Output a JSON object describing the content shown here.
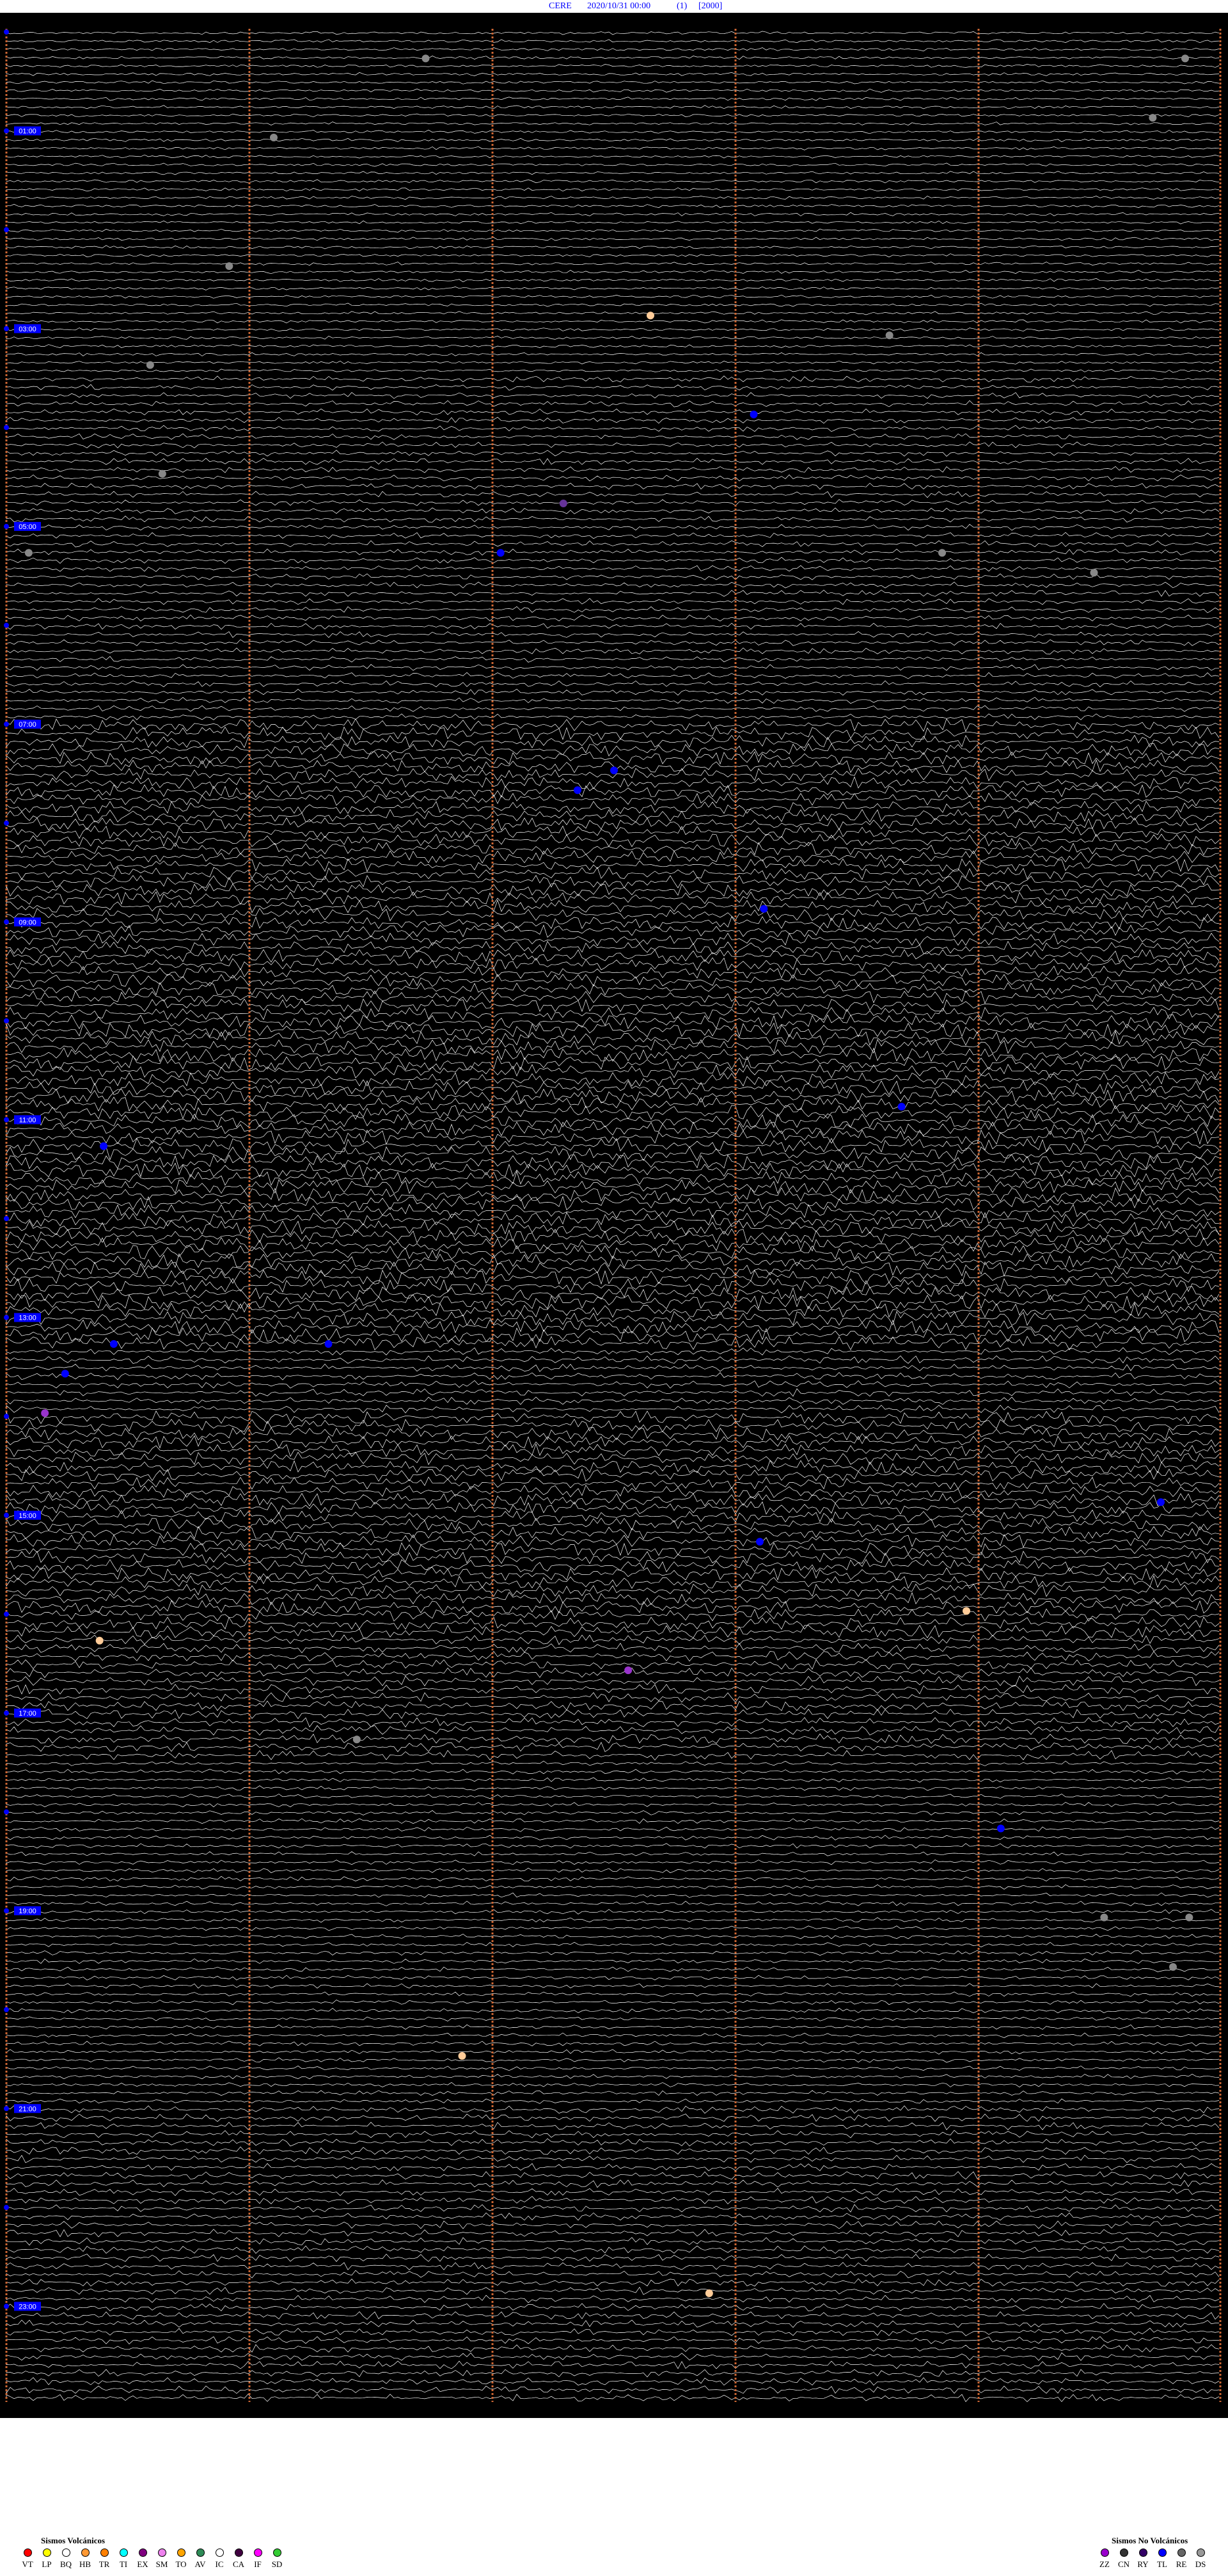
{
  "header": {
    "station": "CERE",
    "datetime": "2020/10/31 00:00",
    "component": "(1)",
    "scale": "[2000]"
  },
  "chart_data": {
    "type": "scatter",
    "title": "CERE 2020/10/31 00:00 (1) [2000]",
    "hour_labels": [
      "01:00",
      "03:00",
      "05:00",
      "07:00",
      "09:00",
      "11:00",
      "13:00",
      "15:00",
      "17:00",
      "19:00",
      "21:00",
      "23:00"
    ],
    "x_range_minutes": [
      0,
      60
    ],
    "y_range_hours": [
      0,
      24
    ],
    "minute_markers": [
      0,
      12,
      24,
      36,
      48,
      60
    ],
    "events": [
      {
        "type": "DS",
        "hour": 0.3,
        "minute": 20.7
      },
      {
        "type": "DS",
        "hour": 0.3,
        "minute": 58.2
      },
      {
        "type": "DS",
        "hour": 0.9,
        "minute": 56.6
      },
      {
        "type": "DS",
        "hour": 1.1,
        "minute": 13.2
      },
      {
        "type": "DS",
        "hour": 2.4,
        "minute": 11.0
      },
      {
        "type": "HB",
        "hour": 2.9,
        "minute": 31.8
      },
      {
        "type": "DS",
        "hour": 3.1,
        "minute": 43.6
      },
      {
        "type": "DS",
        "hour": 3.4,
        "minute": 7.1
      },
      {
        "type": "TL",
        "hour": 3.9,
        "minute": 36.9
      },
      {
        "type": "DS",
        "hour": 4.5,
        "minute": 7.7
      },
      {
        "type": "EX",
        "hour": 4.8,
        "minute": 27.5
      },
      {
        "type": "TL",
        "hour": 5.3,
        "minute": 24.4
      },
      {
        "type": "DS",
        "hour": 5.3,
        "minute": 1.1
      },
      {
        "type": "DS",
        "hour": 5.3,
        "minute": 46.2
      },
      {
        "type": "DS",
        "hour": 5.5,
        "minute": 53.7
      },
      {
        "type": "TL",
        "hour": 7.5,
        "minute": 30.0
      },
      {
        "type": "TL",
        "hour": 7.7,
        "minute": 28.2
      },
      {
        "type": "TL",
        "hour": 8.9,
        "minute": 37.4
      },
      {
        "type": "TL",
        "hour": 10.9,
        "minute": 44.2
      },
      {
        "type": "TL",
        "hour": 11.3,
        "minute": 4.8
      },
      {
        "type": "TL",
        "hour": 13.3,
        "minute": 5.3
      },
      {
        "type": "TL",
        "hour": 13.3,
        "minute": 15.9
      },
      {
        "type": "TL",
        "hour": 13.6,
        "minute": 2.9
      },
      {
        "type": "SM",
        "hour": 14.0,
        "minute": 1.9
      },
      {
        "type": "TL",
        "hour": 14.9,
        "minute": 57.0
      },
      {
        "type": "TL",
        "hour": 15.3,
        "minute": 37.2
      },
      {
        "type": "HB",
        "hour": 16.0,
        "minute": 47.4
      },
      {
        "type": "HB",
        "hour": 16.3,
        "minute": 4.6
      },
      {
        "type": "SM",
        "hour": 16.6,
        "minute": 30.7
      },
      {
        "type": "DS",
        "hour": 17.3,
        "minute": 17.3
      },
      {
        "type": "TL",
        "hour": 18.2,
        "minute": 49.1
      },
      {
        "type": "DS",
        "hour": 19.1,
        "minute": 54.2
      },
      {
        "type": "DS",
        "hour": 19.1,
        "minute": 58.4
      },
      {
        "type": "DS",
        "hour": 19.6,
        "minute": 57.6
      },
      {
        "type": "HB",
        "hour": 20.5,
        "minute": 22.5
      },
      {
        "type": "HB",
        "hour": 22.9,
        "minute": 34.7
      }
    ]
  },
  "legend_volcanic": {
    "title": "Sismos Volcánicos",
    "items": [
      {
        "code": "VT",
        "color": "#ff0000"
      },
      {
        "code": "LP",
        "color": "#ffff00"
      },
      {
        "code": "BQ",
        "color": "#ffffff"
      },
      {
        "code": "HB",
        "color": "#ff9933"
      },
      {
        "code": "TR",
        "color": "#ff8000"
      },
      {
        "code": "TI",
        "color": "#00ffff"
      },
      {
        "code": "EX",
        "color": "#800080"
      },
      {
        "code": "SM",
        "color": "#ee82ee"
      },
      {
        "code": "TO",
        "color": "#ffa500"
      },
      {
        "code": "AV",
        "color": "#2e8b57"
      },
      {
        "code": "IC",
        "color": "#ffffff"
      },
      {
        "code": "CA",
        "color": "#400040"
      },
      {
        "code": "IF",
        "color": "#ff00ff"
      },
      {
        "code": "SD",
        "color": "#33cc33"
      }
    ]
  },
  "legend_nonvolcanic": {
    "title": "Sismos No Volcánicos",
    "items": [
      {
        "code": "ZZ",
        "color": "#9900cc"
      },
      {
        "code": "CN",
        "color": "#333333"
      },
      {
        "code": "RY",
        "color": "#330066"
      },
      {
        "code": "TL",
        "color": "#0000ff"
      },
      {
        "code": "RE",
        "color": "#666666"
      },
      {
        "code": "DS",
        "color": "#999999"
      }
    ]
  },
  "colors": {
    "trace": "#ffffff",
    "background": "#000000",
    "minute_marker": "#cc6633",
    "hour_label": "#0000ff",
    "TL": "#0000ff",
    "HB": "#ffcc99",
    "DS": "#888888",
    "SM": "#9933cc",
    "EX": "#663399"
  },
  "band_noise": [
    {
      "from": 0,
      "to": 3.5,
      "level": 0.25
    },
    {
      "from": 3.5,
      "to": 7.0,
      "level": 0.45
    },
    {
      "from": 7.0,
      "to": 10.0,
      "level": 0.9
    },
    {
      "from": 10.0,
      "to": 13.3,
      "level": 1.0
    },
    {
      "from": 13.3,
      "to": 14.0,
      "level": 0.55
    },
    {
      "from": 14.0,
      "to": 16.2,
      "level": 0.9
    },
    {
      "from": 16.2,
      "to": 17.5,
      "level": 0.7
    },
    {
      "from": 17.5,
      "to": 21.0,
      "level": 0.35
    },
    {
      "from": 21.0,
      "to": 24.0,
      "level": 0.55
    }
  ]
}
